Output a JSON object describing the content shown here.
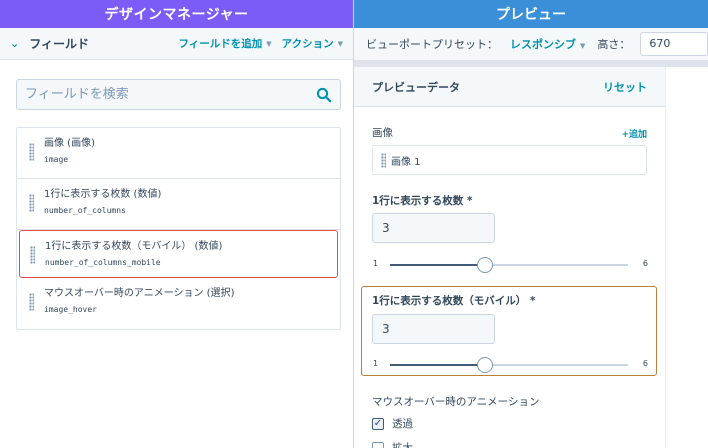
{
  "left": {
    "title": "デザインマネージャー",
    "fields_bar": {
      "chevron": "⌄",
      "title": "フィールド",
      "add_field": "フィールドを追加",
      "actions": "アクション"
    },
    "search": {
      "placeholder": "フィールドを検索"
    },
    "fields": [
      {
        "label": "画像 (画像)",
        "name": "image"
      },
      {
        "label": "1行に表示する枚数 (数値)",
        "name": "number_of_columns"
      },
      {
        "label": "1行に表示する枚数（モバイル） (数値)",
        "name": "number_of_columns_mobile",
        "selected": true
      },
      {
        "label": "マウスオーバー時のアニメーション (選択)",
        "name": "image_hover"
      }
    ]
  },
  "right": {
    "title": "プレビュー",
    "viewport_preset_label": "ビューポートプリセット：",
    "viewport_preset_value": "レスポンシブ",
    "height_label": "高さ：",
    "height_value": "670",
    "preview_data": {
      "title": "プレビューデータ",
      "reset": "リセット",
      "image_section": {
        "label": "画像",
        "add": "+追加",
        "item": "画像 1"
      },
      "columns": {
        "label": "1行に表示する枚数 *",
        "value": "3",
        "min": "1",
        "max": "6",
        "slider_min": 1,
        "slider_max": 6,
        "slider_value": 3
      },
      "columns_mobile": {
        "label": "1行に表示する枚数（モバイル） *",
        "value": "3",
        "min": "1",
        "max": "6",
        "slider_min": 1,
        "slider_max": 6,
        "slider_value": 3
      },
      "hover": {
        "label": "マウスオーバー時のアニメーション",
        "options": [
          {
            "label": "透過",
            "checked": true
          },
          {
            "label": "拡大",
            "checked": false
          }
        ]
      }
    }
  },
  "colors": {
    "left_header": "#7c5cf6",
    "right_header": "#3a8fd8",
    "accent_link": "#0091ae",
    "selected_border": "#e04e4e",
    "highlight_border": "#b5823d"
  },
  "icons": {
    "search": "search-icon",
    "grip": "drag-handle-icon",
    "check": "checkmark-icon"
  }
}
